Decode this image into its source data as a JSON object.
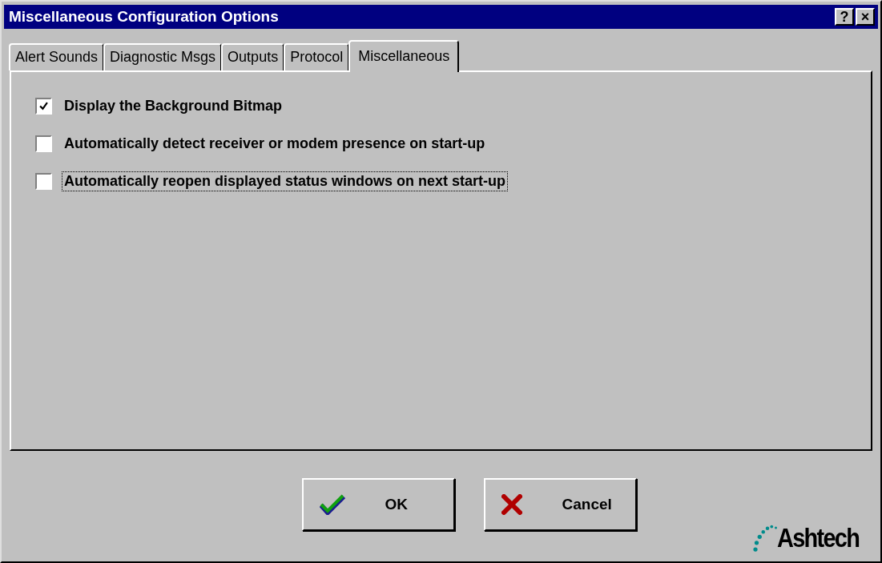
{
  "window": {
    "title": "Miscellaneous Configuration Options",
    "title_buttons": [
      "?",
      "×"
    ]
  },
  "tabs": [
    {
      "label": "Alert Sounds",
      "selected": false
    },
    {
      "label": "Diagnostic Msgs",
      "selected": false
    },
    {
      "label": "Outputs",
      "selected": false
    },
    {
      "label": "Protocol",
      "selected": false
    },
    {
      "label": "Miscellaneous",
      "selected": true
    }
  ],
  "options": [
    {
      "label": "Display the Background Bitmap",
      "checked": true,
      "focused": false
    },
    {
      "label": "Automatically detect receiver or modem presence on start-up",
      "checked": false,
      "focused": false
    },
    {
      "label": "Automatically reopen displayed status windows on next start-up",
      "checked": false,
      "focused": true
    }
  ],
  "buttons": [
    {
      "label": "OK",
      "kind": "ok"
    },
    {
      "label": "Cancel",
      "kind": "cancel"
    }
  ],
  "logo": {
    "text": "Ashtech"
  }
}
